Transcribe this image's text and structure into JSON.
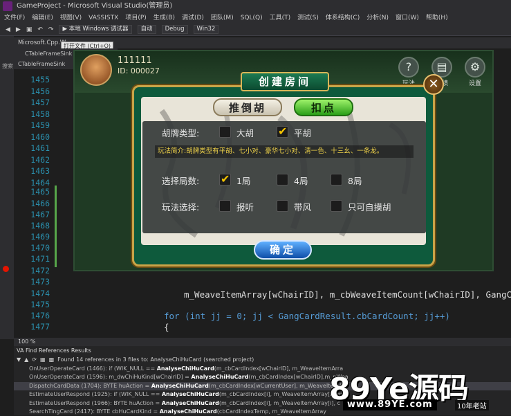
{
  "window": {
    "title": "GameProject - Microsoft Visual Studio(管理员)"
  },
  "menu": [
    "文件(F)",
    "编辑(E)",
    "视图(V)",
    "VASSISTX",
    "项目(P)",
    "生成(B)",
    "调试(D)",
    "团队(M)",
    "SQL(Q)",
    "工具(T)",
    "测试(S)",
    "体系结构(C)",
    "分析(N)",
    "窗口(W)",
    "帮助(H)"
  ],
  "toolbar": {
    "run_label": "▶ 本地 Windows 调试器",
    "auto": "自动",
    "config": "Debug",
    "platform": "Win32"
  },
  "tabs": {
    "file1": "Microsoft.Cpp.W...",
    "file2": "CTableFrameSink",
    "file3": "CTableFrameSink",
    "tooltip": "打开文件 (Ctrl+O)",
    "left_label": "搜索"
  },
  "editor": {
    "line_numbers": [
      "1455",
      "1456",
      "1457",
      "1458",
      "1459",
      "1460",
      "1461",
      "1462",
      "1463",
      "1464",
      "1465",
      "1466",
      "1467",
      "1468",
      "1469",
      "1470",
      "1471",
      "1472",
      "1473",
      "1474",
      "1475",
      "1476",
      "1477"
    ],
    "code_right1": "m_WeaveItemArray[wChairID], m_cbWeaveItemCount[wChairID], GangC",
    "code_for": "for (int jj = 0; jj < GangCardResult.cbCardCount; jj++)",
    "code_brace": "{",
    "zoom": "100 %"
  },
  "va_panel": {
    "title": "VA Find References Results",
    "summary": "Found 14 references in 3 files to: AnalyseChiHuCard (searched project)",
    "rows": [
      {
        "pre": "OnUserOperateCard (1466):  if (WIK_NULL == ",
        "hit": "AnalyseChiHuCard",
        "post": "(m_cbCardIndex[wChairID], m_WeaveItemArra"
      },
      {
        "pre": "OnUserOperateCard (1596):  m_dwChiHuKind[wChairID] = ",
        "hit": "AnalyseChiHuCard",
        "post": "(m_cbCardIndex[wChairID],m_pWea"
      },
      {
        "pre": "DispatchCardData (1704):  BYTE huAction = ",
        "hit": "AnalyseChiHuCard",
        "post": "(m_cbCardIndex[wCurrentUser], m_WeaveItemA"
      },
      {
        "pre": "EstimateUserRespond (1925):  if (WIK_NULL == ",
        "hit": "AnalyseChiHuCard",
        "post": "(m_cbCardIndex[i], m_WeaveItemArray[i], m"
      },
      {
        "pre": "EstimateUserRespond (1966):  BYTE huAction = ",
        "hit": "AnalyseChiHuCard",
        "post": "(m_cbCardIndex[i], m_WeaveItemArray[i], c"
      },
      {
        "pre": "SearchTingCard (2417):  BYTE cbHuCardKind = ",
        "hit": "AnalyseChiHuCard",
        "post": "(cbCardIndexTemp, m_WeaveItemArray"
      }
    ]
  },
  "game": {
    "player_name": "111111",
    "player_id": "ID: 000027",
    "icons": [
      {
        "glyph": "?",
        "label": "玩法"
      },
      {
        "glyph": "▤",
        "label": "战绩"
      },
      {
        "glyph": "⚙",
        "label": "设置"
      }
    ]
  },
  "dialog": {
    "title": "创建房间",
    "tab_left": "推倒胡",
    "tab_right": "扣点",
    "row1_label": "胡牌类型:",
    "row1_options": [
      {
        "label": "大胡",
        "checked": false
      },
      {
        "label": "平胡",
        "checked": true
      }
    ],
    "description": "玩法简介:胡牌类型有平胡、七小对、豪华七小对、清一色、十三幺、一条龙。",
    "row2_label": "选择局数:",
    "row2_options": [
      {
        "label": "1局",
        "checked": true
      },
      {
        "label": "4局",
        "checked": false
      },
      {
        "label": "8局",
        "checked": false
      }
    ],
    "row3_label": "玩法选择:",
    "row3_options": [
      {
        "label": "报听",
        "checked": false
      },
      {
        "label": "带风",
        "checked": false
      },
      {
        "label": "只可自摸胡",
        "checked": false
      }
    ],
    "ok_label": "确定"
  },
  "watermark": {
    "big": "89Ye源码",
    "url": "www.89YE.com",
    "tag": "10年老站"
  }
}
